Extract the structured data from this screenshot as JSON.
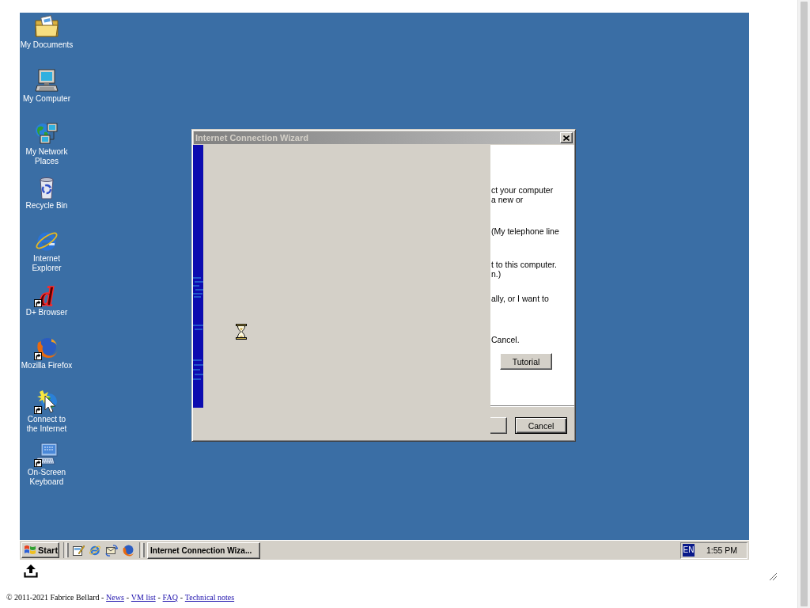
{
  "desktop_icons": [
    {
      "label": "My Documents",
      "shortcut": false
    },
    {
      "label": "My Computer",
      "shortcut": false
    },
    {
      "label": "My Network\nPlaces",
      "shortcut": false
    },
    {
      "label": "Recycle Bin",
      "shortcut": false
    },
    {
      "label": "Internet\nExplorer",
      "shortcut": false
    },
    {
      "label": "D+ Browser",
      "shortcut": true,
      "icon_glyph": "d"
    },
    {
      "label": "Mozilla Firefox",
      "shortcut": true
    },
    {
      "label": "Connect to\nthe Internet",
      "shortcut": true
    },
    {
      "label": "On-Screen\nKeyboard",
      "shortcut": true
    }
  ],
  "window": {
    "title": "Internet Connection Wizard",
    "active": false,
    "page_text": [
      [
        "ct your computer",
        "a new or"
      ],
      [
        "(My telephone line"
      ],
      [
        "t to this computer.",
        "n.)"
      ],
      [
        "ally, or I want to"
      ],
      [
        "Cancel."
      ]
    ],
    "page_button": "Tutorial",
    "buttons": [
      {
        "label": "Cancel",
        "default": true
      }
    ]
  },
  "taskbar": {
    "start_button": "Start",
    "tasks": [
      {
        "label": "Internet Connection Wiza...",
        "selected": false
      }
    ],
    "tray": {
      "language": "EN",
      "clock": "1:55 PM"
    }
  },
  "footer": {
    "parts": [
      {
        "text": "© 2011-2021 Fabrice Bellard -",
        "link": false
      },
      {
        "text": "News",
        "link": true
      },
      {
        "text": "-",
        "link": false
      },
      {
        "text": "VM list",
        "link": true
      },
      {
        "text": "-",
        "link": false
      },
      {
        "text": "FAQ",
        "link": true
      },
      {
        "text": "-",
        "link": false
      },
      {
        "text": "Technical notes",
        "link": true
      }
    ]
  }
}
